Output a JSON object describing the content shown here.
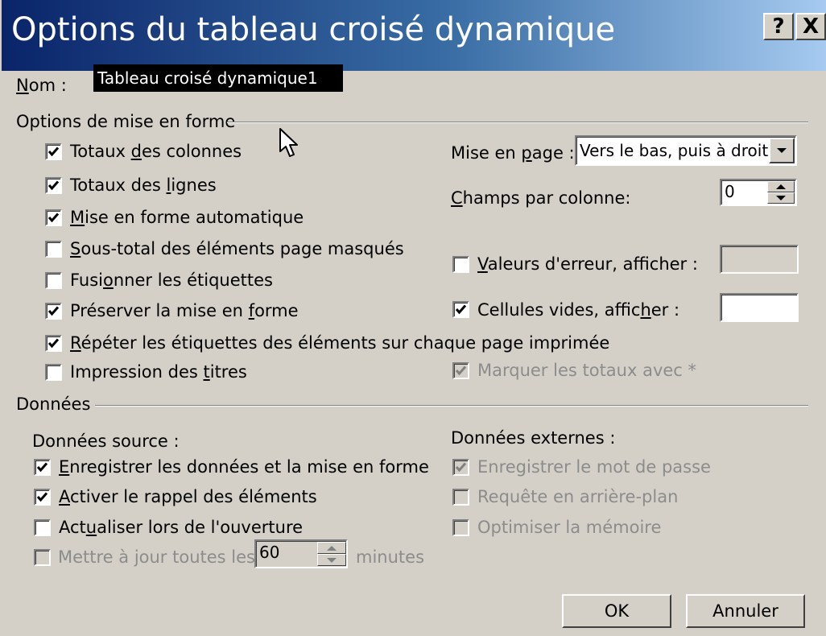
{
  "window": {
    "title": "Options du tableau croisé dynamique",
    "help_label": "?",
    "close_label": "X"
  },
  "name": {
    "label_first": "N",
    "label_rest": "om :",
    "value": "Tableau croisé dynamique1"
  },
  "format_section": {
    "title": "Options de mise en forme",
    "checkboxes": [
      {
        "pre": "Totaux ",
        "key": "d",
        "post": "es colonnes",
        "checked": true,
        "enabled": true
      },
      {
        "pre": "Totaux des ",
        "key": "l",
        "post": "ignes",
        "checked": true,
        "enabled": true
      },
      {
        "pre": "",
        "key": "M",
        "post": "ise en forme automatique",
        "checked": true,
        "enabled": true
      },
      {
        "pre": "",
        "key": "S",
        "post": "ous-total des éléments page masqués",
        "checked": false,
        "enabled": true
      },
      {
        "pre": "Fusi",
        "key": "o",
        "post": "nner les étiquettes",
        "checked": false,
        "enabled": true
      },
      {
        "pre": "Préserver la mise en ",
        "key": "f",
        "post": "orme",
        "checked": true,
        "enabled": true
      },
      {
        "pre": "",
        "key": "R",
        "post": "épéter les étiquettes des éléments sur chaque page imprimée",
        "checked": true,
        "enabled": true
      },
      {
        "pre": "Impression des ",
        "key": "t",
        "post": "itres",
        "checked": false,
        "enabled": true
      }
    ],
    "layout_label_pre": "Mise en ",
    "layout_label_key": "p",
    "layout_label_post": "age :",
    "layout_value": "Vers le bas, puis à droite",
    "fields_label_key": "C",
    "fields_label_post": "hamps par colonne:",
    "fields_value": "0",
    "error_values": {
      "pre": "",
      "key": "V",
      "post": "aleurs d'erreur, afficher :",
      "checked": false,
      "value": ""
    },
    "empty_cells": {
      "pre": "Cellules vides, affic",
      "key": "h",
      "post": "er :",
      "checked": true,
      "value": ""
    },
    "mark_totals": {
      "label": "Marquer les totaux avec *",
      "checked": true
    }
  },
  "data_section": {
    "title": "Données",
    "source_title": "Données source :",
    "source_items": [
      {
        "pre": "",
        "key": "E",
        "post": "nregistrer les données et la mise en forme",
        "checked": true,
        "enabled": true
      },
      {
        "pre": "",
        "key": "A",
        "post": "ctiver le rappel des éléments",
        "checked": true,
        "enabled": true
      },
      {
        "pre": "Act",
        "key": "u",
        "post": "aliser lors de l'ouverture",
        "checked": false,
        "enabled": true
      }
    ],
    "refresh": {
      "label": "Mettre à jour toutes les",
      "value": "60",
      "unit": "minutes",
      "checked": false
    },
    "external_title": "Données externes :",
    "external_items": [
      {
        "label": "Enregistrer le mot de passe",
        "checked": true
      },
      {
        "label": "Requête en arrière-plan",
        "checked": false
      },
      {
        "label": "Optimiser la mémoire",
        "checked": false
      }
    ]
  },
  "buttons": {
    "ok": "OK",
    "cancel": "Annuler"
  },
  "colors": {
    "face": "#d4d0c8",
    "title_start": "#0a246a",
    "title_end": "#a6caf0",
    "disabled_text": "#8c8c8c"
  },
  "icons": [
    "checkmark-icon",
    "dropdown-arrow-icon",
    "spin-up-icon",
    "spin-down-icon",
    "mouse-pointer-icon"
  ]
}
